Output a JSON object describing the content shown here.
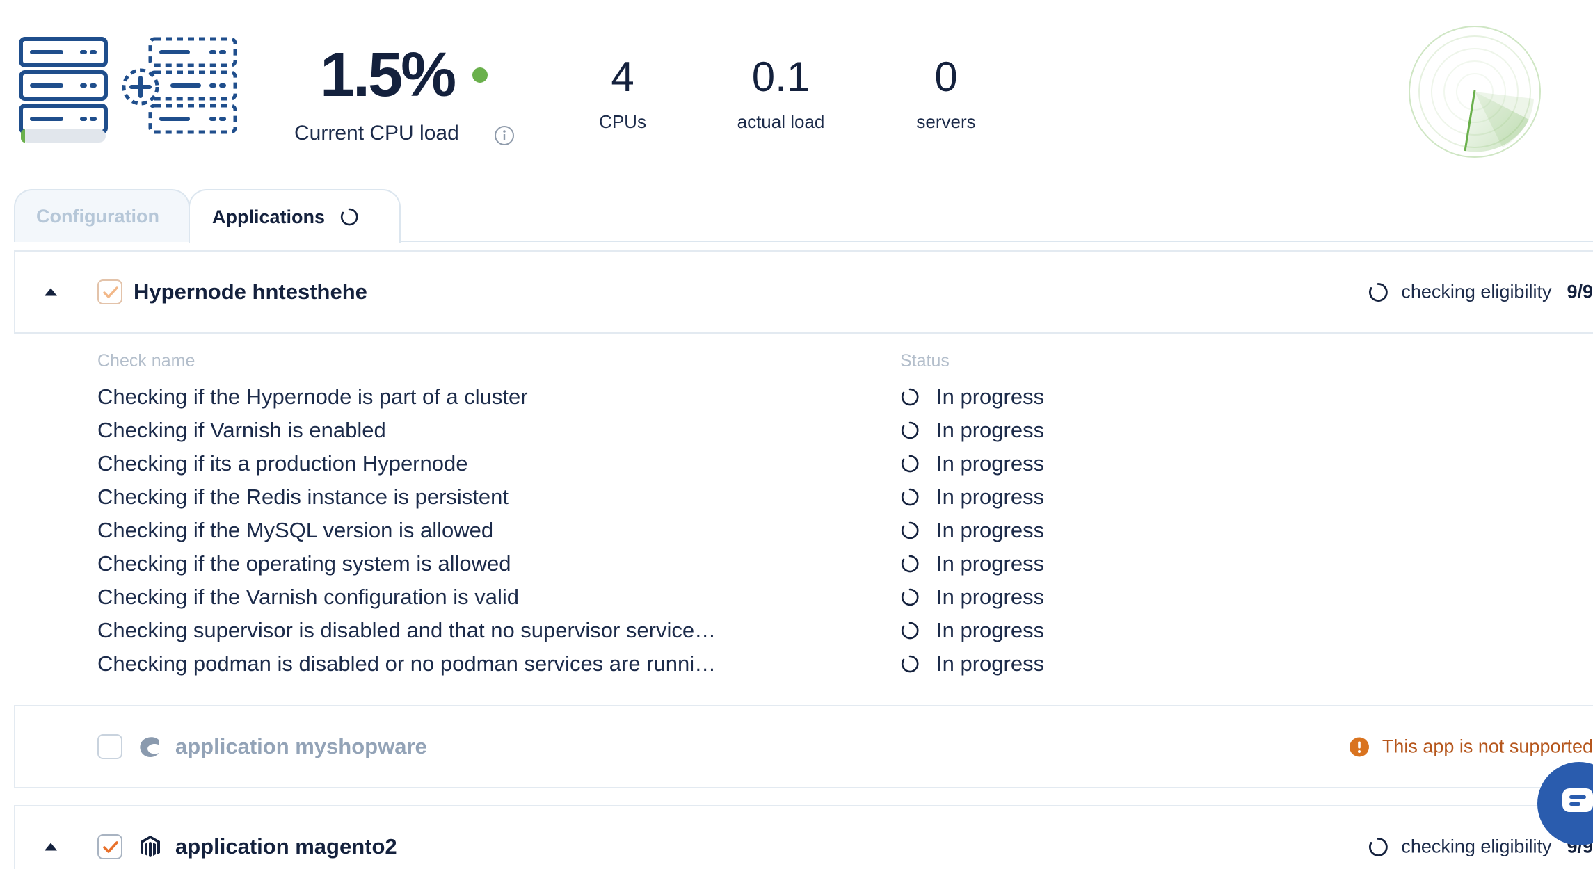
{
  "header": {
    "cpu_load_value": "1.5%",
    "cpu_load_label": "Current CPU load",
    "cpu_status_color": "#6ab04c",
    "info_icon": "info-icon",
    "stats": [
      {
        "value": "4",
        "label": "CPUs"
      },
      {
        "value": "0.1",
        "label": "actual load"
      },
      {
        "value": "0",
        "label": "servers"
      }
    ],
    "server_usage_fraction": 0.05
  },
  "tabs": [
    {
      "label": "Configuration",
      "active": false
    },
    {
      "label": "Applications",
      "active": true,
      "icon": "spinner-icon"
    }
  ],
  "panels": {
    "hypernode": {
      "title": "Hypernode hntesthehe",
      "checked": true,
      "status_text": "checking eligibility",
      "status_count": "9/9"
    },
    "shopware": {
      "title": "application myshopware",
      "checked": false,
      "icon": "shopware-icon",
      "status_text": "This app is not supported",
      "status_color": "#d9731f"
    },
    "magento": {
      "title": "application magento2",
      "checked": true,
      "icon": "magento-icon",
      "status_text": "checking eligibility",
      "status_count": "9/9"
    }
  },
  "checks": {
    "col_name": "Check name",
    "col_status": "Status",
    "rows": [
      {
        "name": "Checking if the Hypernode is part of a cluster",
        "status": "In progress"
      },
      {
        "name": "Checking if Varnish is enabled",
        "status": "In progress"
      },
      {
        "name": "Checking if its a production Hypernode",
        "status": "In progress"
      },
      {
        "name": "Checking if the Redis instance is persistent",
        "status": "In progress"
      },
      {
        "name": "Checking if the MySQL version is allowed",
        "status": "In progress"
      },
      {
        "name": "Checking if the operating system is allowed",
        "status": "In progress"
      },
      {
        "name": "Checking if the Varnish configuration is valid",
        "status": "In progress"
      },
      {
        "name": "Checking supervisor is disabled and that no supervisor service…",
        "status": "In progress"
      },
      {
        "name": "Checking podman is disabled or no podman services are runni…",
        "status": "In progress"
      }
    ]
  },
  "colors": {
    "navy": "#14213d",
    "accent_green": "#6ab04c",
    "warning_orange": "#d9731f",
    "checkbox_orange": "#e8702a",
    "chat_blue": "#2a5cae"
  }
}
